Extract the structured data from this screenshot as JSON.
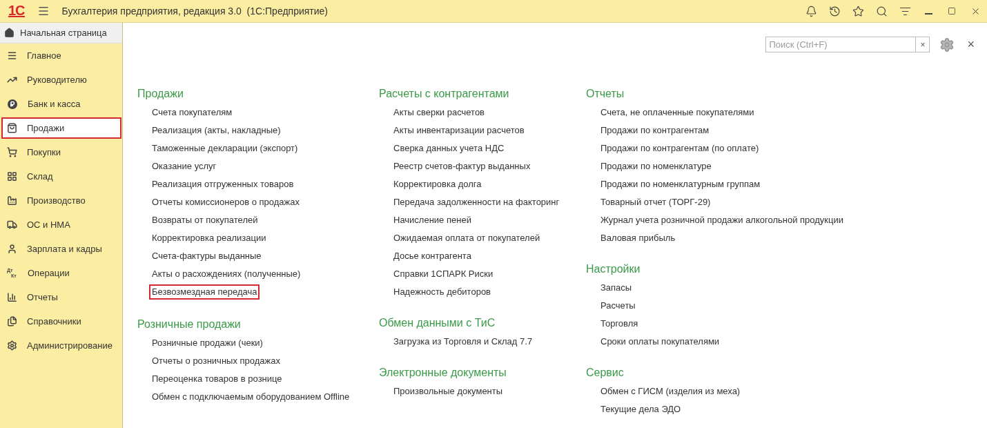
{
  "window": {
    "logo": "1С",
    "title": "Бухгалтерия предприятия, редакция 3.0  (1С:Предприятие)"
  },
  "home_tab": {
    "label": "Начальная страница"
  },
  "sidebar": {
    "items": [
      {
        "label": "Главное",
        "selected": false
      },
      {
        "label": "Руководителю",
        "selected": false
      },
      {
        "label": "Банк и касса",
        "selected": false
      },
      {
        "label": "Продажи",
        "selected": true
      },
      {
        "label": "Покупки",
        "selected": false
      },
      {
        "label": "Склад",
        "selected": false
      },
      {
        "label": "Производство",
        "selected": false
      },
      {
        "label": "ОС и НМА",
        "selected": false
      },
      {
        "label": "Зарплата и кадры",
        "selected": false
      },
      {
        "label": "Операции",
        "icon_text": [
          "Дт",
          "Кт"
        ],
        "selected": false
      },
      {
        "label": "Отчеты",
        "selected": false
      },
      {
        "label": "Справочники",
        "selected": false
      },
      {
        "label": "Администрирование",
        "selected": false
      }
    ]
  },
  "search": {
    "placeholder": "Поиск (Ctrl+F)",
    "clear": "×"
  },
  "close": "×",
  "columns": [
    [
      {
        "title": "Продажи",
        "items": [
          {
            "label": "Счета покупателям",
            "highlighted": false
          },
          {
            "label": "Реализация (акты, накладные)",
            "highlighted": false
          },
          {
            "label": "Таможенные декларации (экспорт)",
            "highlighted": false
          },
          {
            "label": "Оказание услуг",
            "highlighted": false
          },
          {
            "label": "Реализация отгруженных товаров",
            "highlighted": false
          },
          {
            "label": "Отчеты комиссионеров о продажах",
            "highlighted": false
          },
          {
            "label": "Возвраты от покупателей",
            "highlighted": false
          },
          {
            "label": "Корректировка реализации",
            "highlighted": false
          },
          {
            "label": "Счета-фактуры выданные",
            "highlighted": false
          },
          {
            "label": "Акты о расхождениях (полученные)",
            "highlighted": false
          },
          {
            "label": "Безвозмездная передача",
            "highlighted": true
          }
        ]
      },
      {
        "title": "Розничные продажи",
        "items": [
          {
            "label": "Розничные продажи (чеки)",
            "highlighted": false
          },
          {
            "label": "Отчеты о розничных продажах",
            "highlighted": false
          },
          {
            "label": "Переоценка товаров в рознице",
            "highlighted": false
          },
          {
            "label": "Обмен с подключаемым оборудованием Offline",
            "highlighted": false
          }
        ]
      }
    ],
    [
      {
        "title": "Расчеты с контрагентами",
        "items": [
          {
            "label": "Акты сверки расчетов",
            "highlighted": false
          },
          {
            "label": "Акты инвентаризации расчетов",
            "highlighted": false
          },
          {
            "label": "Сверка данных учета НДС",
            "highlighted": false
          },
          {
            "label": "Реестр счетов-фактур выданных",
            "highlighted": false
          },
          {
            "label": "Корректировка долга",
            "highlighted": false
          },
          {
            "label": "Передача задолженности на факторинг",
            "highlighted": false
          },
          {
            "label": "Начисление пеней",
            "highlighted": false
          },
          {
            "label": "Ожидаемая оплата от покупателей",
            "highlighted": false
          },
          {
            "label": "Досье контрагента",
            "highlighted": false
          },
          {
            "label": "Справки 1СПАРК Риски",
            "highlighted": false
          },
          {
            "label": "Надежность дебиторов",
            "highlighted": false
          }
        ]
      },
      {
        "title": "Обмен данными с ТиС",
        "items": [
          {
            "label": "Загрузка из Торговля и Склад 7.7",
            "highlighted": false
          }
        ]
      },
      {
        "title": "Электронные документы",
        "items": [
          {
            "label": "Произвольные документы",
            "highlighted": false
          }
        ]
      }
    ],
    [
      {
        "title": "Отчеты",
        "items": [
          {
            "label": "Счета, не оплаченные покупателями",
            "highlighted": false
          },
          {
            "label": "Продажи по контрагентам",
            "highlighted": false
          },
          {
            "label": "Продажи по контрагентам (по оплате)",
            "highlighted": false
          },
          {
            "label": "Продажи по номенклатуре",
            "highlighted": false
          },
          {
            "label": "Продажи по номенклатурным группам",
            "highlighted": false
          },
          {
            "label": "Товарный отчет (ТОРГ-29)",
            "highlighted": false
          },
          {
            "label": "Журнал учета розничной продажи алкогольной продукции",
            "highlighted": false
          },
          {
            "label": "Валовая прибыль",
            "highlighted": false
          }
        ]
      },
      {
        "title": "Настройки",
        "items": [
          {
            "label": "Запасы",
            "highlighted": false
          },
          {
            "label": "Расчеты",
            "highlighted": false
          },
          {
            "label": "Торговля",
            "highlighted": false
          },
          {
            "label": "Сроки оплаты покупателями",
            "highlighted": false
          }
        ]
      },
      {
        "title": "Сервис",
        "items": [
          {
            "label": "Обмен с ГИСМ (изделия из меха)",
            "highlighted": false
          },
          {
            "label": "Текущие дела ЭДО",
            "highlighted": false
          }
        ]
      }
    ]
  ]
}
